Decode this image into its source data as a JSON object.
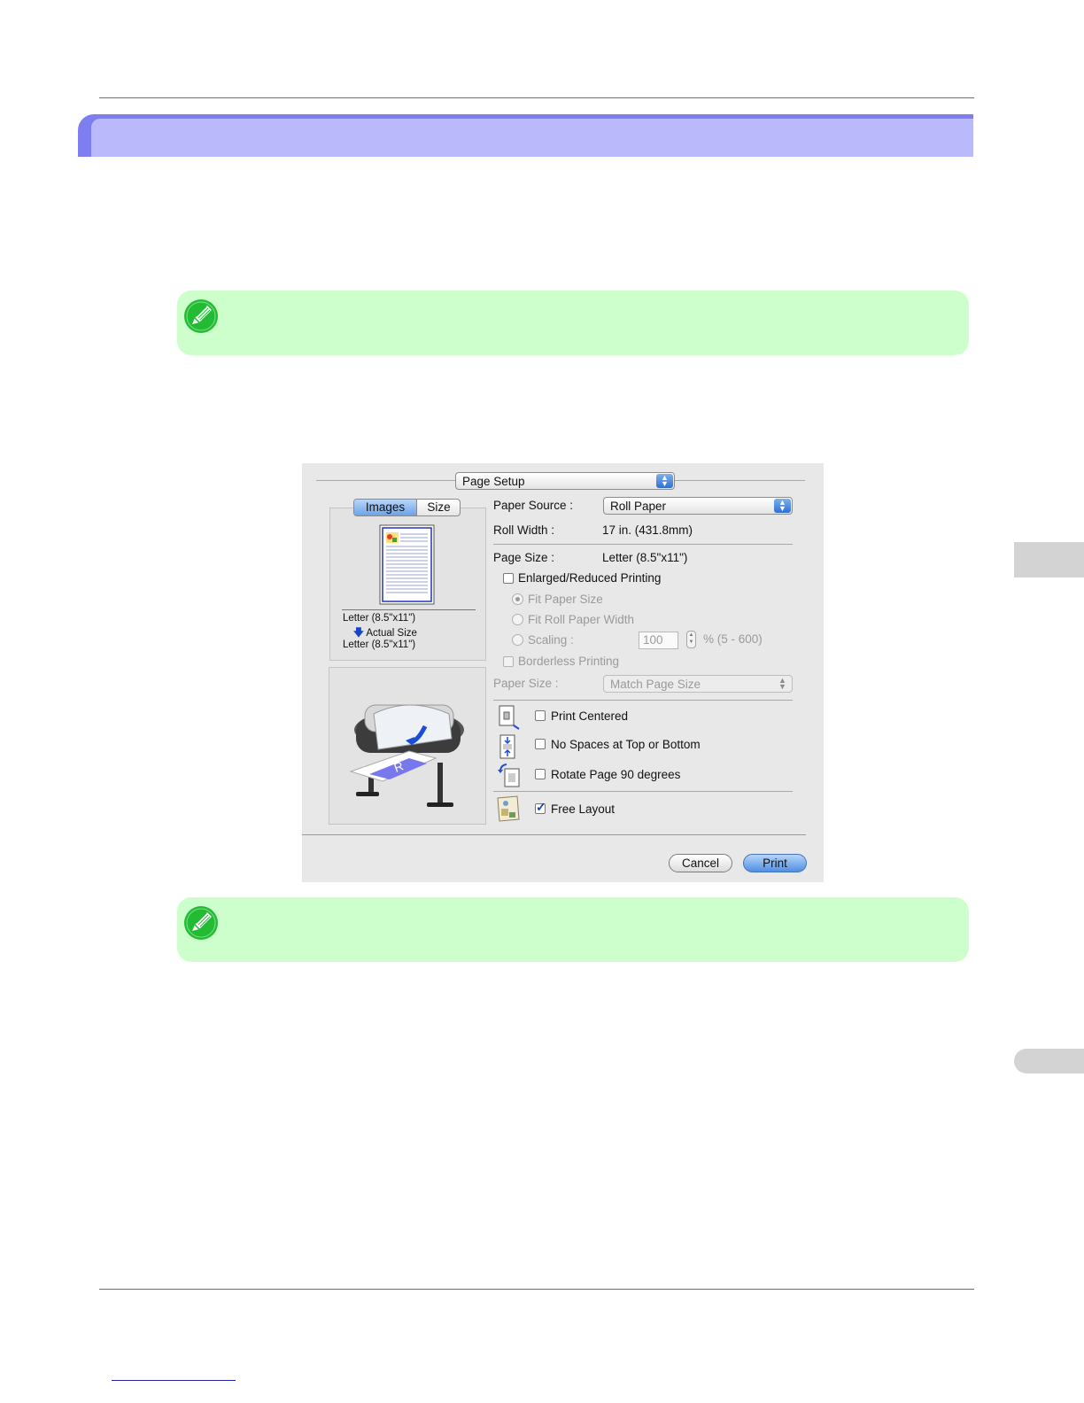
{
  "dialog": {
    "title_popup": "Page Setup",
    "preview_tabs": [
      "Images",
      "Size"
    ],
    "preview_info": {
      "original": "Letter (8.5\"x11\")",
      "mode": "Actual Size",
      "output": "Letter (8.5\"x11\")"
    },
    "paper_source_label": "Paper Source :",
    "paper_source_value": "Roll Paper",
    "roll_width_label": "Roll Width :",
    "roll_width_value": "17 in. (431.8mm)",
    "page_size_label": "Page Size :",
    "page_size_value": "Letter (8.5\"x11\")",
    "enlarged_reduced_label": "Enlarged/Reduced Printing",
    "fit_paper_size_label": "Fit Paper Size",
    "fit_roll_width_label": "Fit Roll Paper Width",
    "scaling_label": "Scaling :",
    "scaling_value": "100",
    "scaling_range": "% (5 - 600)",
    "borderless_label": "Borderless Printing",
    "paper_size_label": "Paper Size :",
    "paper_size_value": "Match Page Size",
    "print_centered_label": "Print Centered",
    "no_spaces_label": "No Spaces at Top or Bottom",
    "rotate_label": "Rotate Page 90 degrees",
    "free_layout_label": "Free Layout",
    "free_layout_checked": true,
    "cancel_label": "Cancel",
    "print_label": "Print"
  },
  "colors": {
    "header_outer": "#7e7ef0",
    "header_inner": "#b9b9fb",
    "note_bg": "#ccffcc",
    "note_icon": "#22bb33"
  }
}
